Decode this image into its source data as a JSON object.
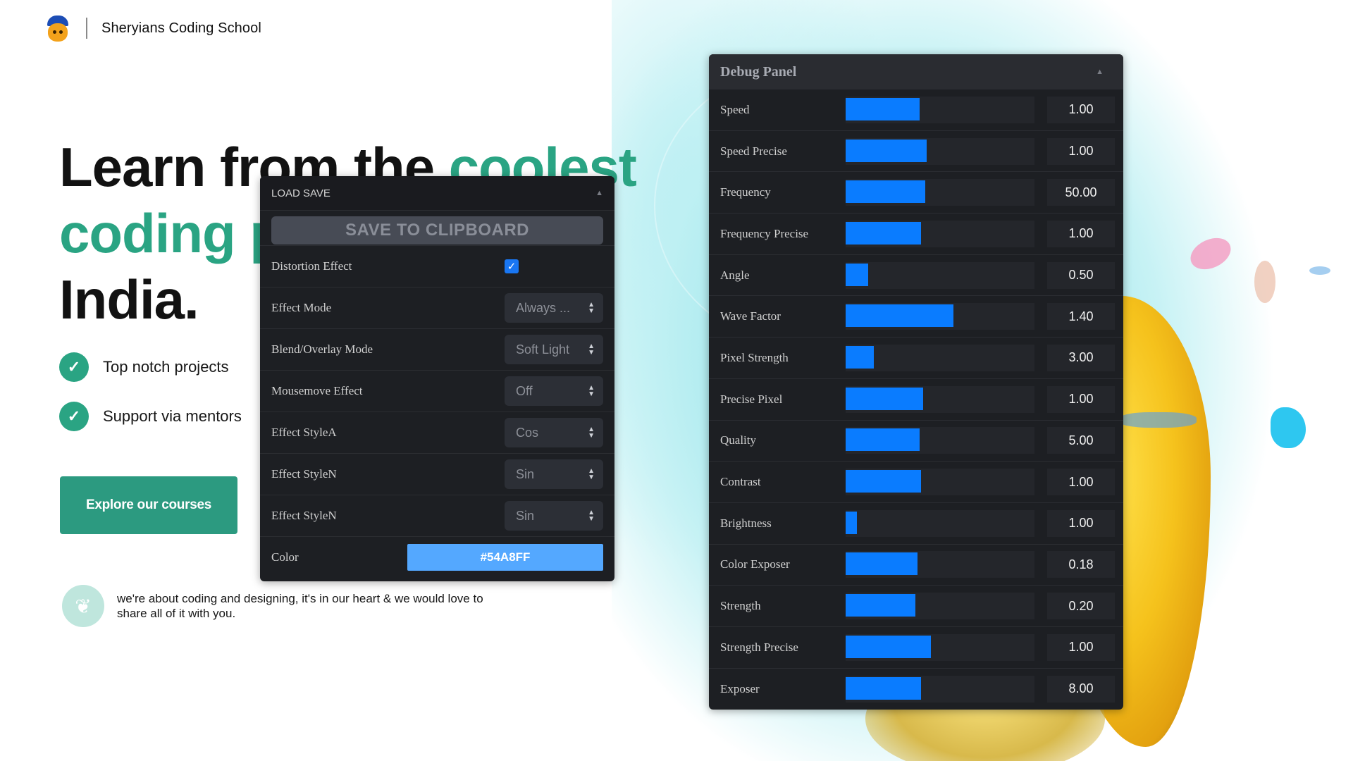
{
  "header": {
    "brand": "Sheryians Coding School",
    "logo_icon": "lion-mascot-icon"
  },
  "hero": {
    "line1": "Learn from the ",
    "line1_accent": "coolest",
    "line2_accent": "coding p",
    "line3": "India.",
    "accent_color": "#2aa483"
  },
  "features": [
    {
      "label": "Top notch projects",
      "icon": "check-icon"
    },
    {
      "label": "Support via mentors",
      "icon": "check-icon"
    }
  ],
  "cta": {
    "label": "Explore our courses"
  },
  "tagline": {
    "text": "we're about coding and designing, it's in our heart & we would love to share all of it with you.",
    "icon": "leaf-icon"
  },
  "load_panel": {
    "title": "LOAD SAVE",
    "save_button": "SAVE TO CLIPBOARD",
    "distortion_label": "Distortion Effect",
    "distortion_checked": true,
    "selects": [
      {
        "label": "Effect Mode",
        "value": "Always ..."
      },
      {
        "label": "Blend/Overlay Mode",
        "value": "Soft Light"
      },
      {
        "label": "Mousemove Effect",
        "value": "Off"
      },
      {
        "label": "Effect StyleA",
        "value": "Cos"
      },
      {
        "label": "Effect StyleN",
        "value": "Sin"
      },
      {
        "label": "Effect StyleN",
        "value": "Sin"
      }
    ],
    "color_label": "Color",
    "color_value": "#54A8FF"
  },
  "debug_panel": {
    "title": "Debug Panel",
    "slider_color": "#0a7cff",
    "rows": [
      {
        "label": "Speed",
        "value": "1.00",
        "level": 0.39
      },
      {
        "label": "Speed Precise",
        "value": "1.00",
        "level": 0.43
      },
      {
        "label": "Frequency",
        "value": "50.00",
        "level": 0.42
      },
      {
        "label": "Frequency Precise",
        "value": "1.00",
        "level": 0.4
      },
      {
        "label": "Angle",
        "value": "0.50",
        "level": 0.12
      },
      {
        "label": "Wave Factor",
        "value": "1.40",
        "level": 0.57
      },
      {
        "label": "Pixel Strength",
        "value": "3.00",
        "level": 0.15
      },
      {
        "label": "Precise Pixel",
        "value": "1.00",
        "level": 0.41
      },
      {
        "label": "Quality",
        "value": "5.00",
        "level": 0.39
      },
      {
        "label": "Contrast",
        "value": "1.00",
        "level": 0.4
      },
      {
        "label": "Brightness",
        "value": "1.00",
        "level": 0.06
      },
      {
        "label": "Color Exposer",
        "value": "0.18",
        "level": 0.38
      },
      {
        "label": "Strength",
        "value": "0.20",
        "level": 0.37
      },
      {
        "label": "Strength Precise",
        "value": "1.00",
        "level": 0.45
      },
      {
        "label": "Exposer",
        "value": "8.00",
        "level": 0.4
      }
    ]
  }
}
